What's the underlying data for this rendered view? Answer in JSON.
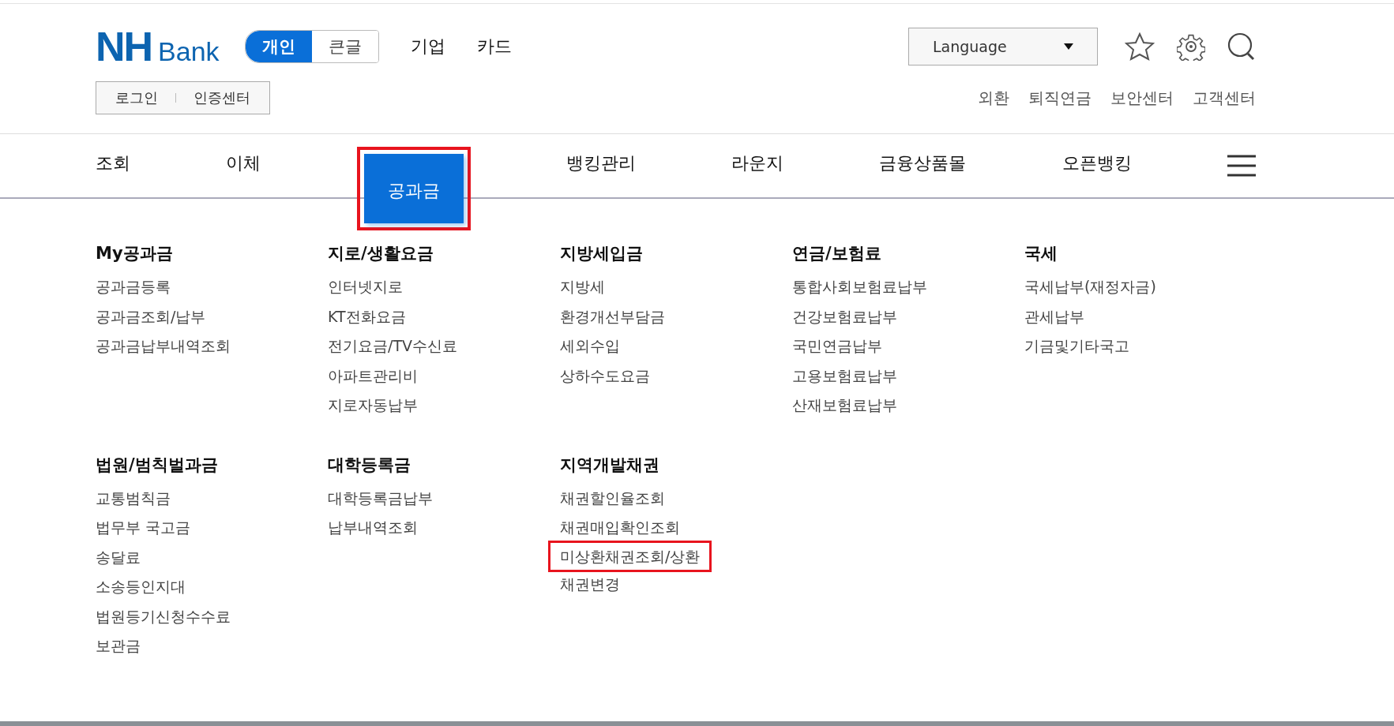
{
  "header": {
    "logo": {
      "mark": "NH",
      "word": "Bank"
    },
    "mode_toggle": [
      {
        "label": "개인",
        "selected": true
      },
      {
        "label": "큰글",
        "selected": false
      }
    ],
    "top_links": [
      "기업",
      "카드"
    ],
    "auth_links": [
      "로그인",
      "인증센터"
    ],
    "language": {
      "value": "Language"
    },
    "util_links": [
      "외환",
      "퇴직연금",
      "보안센터",
      "고객센터"
    ]
  },
  "nav": [
    {
      "label": "조회",
      "selected": false,
      "highlighted": false
    },
    {
      "label": "이체",
      "selected": false,
      "highlighted": false
    },
    {
      "label": "공과금",
      "selected": true,
      "highlighted": true
    },
    {
      "label": "뱅킹관리",
      "selected": false,
      "highlighted": false
    },
    {
      "label": "라운지",
      "selected": false,
      "highlighted": false
    },
    {
      "label": "금융상품몰",
      "selected": false,
      "highlighted": false
    },
    {
      "label": "오픈뱅킹",
      "selected": false,
      "highlighted": false
    }
  ],
  "mega_menu": {
    "rows": [
      [
        {
          "title": "My공과금",
          "items": [
            {
              "label": "공과금등록",
              "highlighted": false
            },
            {
              "label": "공과금조회/납부",
              "highlighted": false
            },
            {
              "label": "공과금납부내역조회",
              "highlighted": false
            }
          ]
        },
        {
          "title": "지로/생활요금",
          "items": [
            {
              "label": "인터넷지로",
              "highlighted": false
            },
            {
              "label": "KT전화요금",
              "highlighted": false
            },
            {
              "label": "전기요금/TV수신료",
              "highlighted": false
            },
            {
              "label": "아파트관리비",
              "highlighted": false
            },
            {
              "label": "지로자동납부",
              "highlighted": false
            }
          ]
        },
        {
          "title": "지방세입금",
          "items": [
            {
              "label": "지방세",
              "highlighted": false
            },
            {
              "label": "환경개선부담금",
              "highlighted": false
            },
            {
              "label": "세외수입",
              "highlighted": false
            },
            {
              "label": "상하수도요금",
              "highlighted": false
            }
          ]
        },
        {
          "title": "연금/보험료",
          "items": [
            {
              "label": "통합사회보험료납부",
              "highlighted": false
            },
            {
              "label": "건강보험료납부",
              "highlighted": false
            },
            {
              "label": "국민연금납부",
              "highlighted": false
            },
            {
              "label": "고용보험료납부",
              "highlighted": false
            },
            {
              "label": "산재보험료납부",
              "highlighted": false
            }
          ]
        },
        {
          "title": "국세",
          "items": [
            {
              "label": "국세납부(재정자금)",
              "highlighted": false
            },
            {
              "label": "관세납부",
              "highlighted": false
            },
            {
              "label": "기금및기타국고",
              "highlighted": false
            }
          ]
        }
      ],
      [
        {
          "title": "법원/범칙벌과금",
          "items": [
            {
              "label": "교통범칙금",
              "highlighted": false
            },
            {
              "label": "법무부 국고금",
              "highlighted": false
            },
            {
              "label": "송달료",
              "highlighted": false
            },
            {
              "label": "소송등인지대",
              "highlighted": false
            },
            {
              "label": "법원등기신청수수료",
              "highlighted": false
            },
            {
              "label": "보관금",
              "highlighted": false
            }
          ]
        },
        {
          "title": "대학등록금",
          "items": [
            {
              "label": "대학등록금납부",
              "highlighted": false
            },
            {
              "label": "납부내역조회",
              "highlighted": false
            }
          ]
        },
        {
          "title": "지역개발채권",
          "items": [
            {
              "label": "채권할인율조회",
              "highlighted": false
            },
            {
              "label": "채권매입확인조회",
              "highlighted": false
            },
            {
              "label": "미상환채권조회/상환",
              "highlighted": true
            },
            {
              "label": "채권변경",
              "highlighted": false
            }
          ]
        }
      ]
    ]
  }
}
